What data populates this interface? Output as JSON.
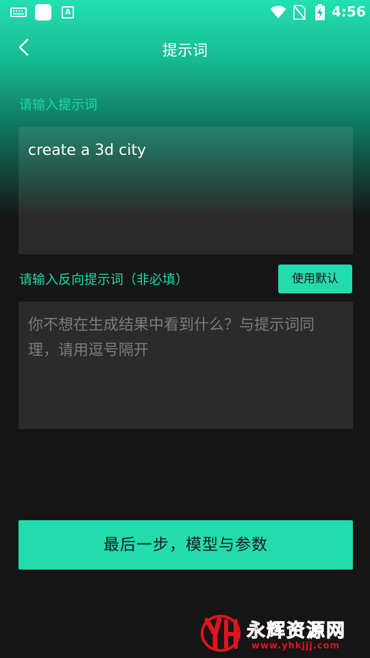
{
  "status_bar": {
    "time": "4:56",
    "app_icon_letter": "A",
    "icons": [
      "keyboard-icon",
      "app-square-icon",
      "text-app-icon",
      "wifi-icon",
      "no-sim-icon",
      "battery-charging-icon"
    ]
  },
  "header": {
    "title": "提示词",
    "back_icon": "chevron-left-icon"
  },
  "prompt": {
    "label": "请输入提示词",
    "value": "create a 3d city"
  },
  "negative_prompt": {
    "label": "请输入反向提示词（非必填）",
    "default_button": "使用默认",
    "placeholder": "你不想在生成结果中看到什么？与提示词同理，请用逗号隔开"
  },
  "next_button": "最后一步，模型与参数",
  "watermark": {
    "title": "永辉资源网",
    "url": "www.yhkjjj.com"
  },
  "colors": {
    "accent": "#22dcac",
    "background": "#151515",
    "watermark": "#e1131e"
  }
}
